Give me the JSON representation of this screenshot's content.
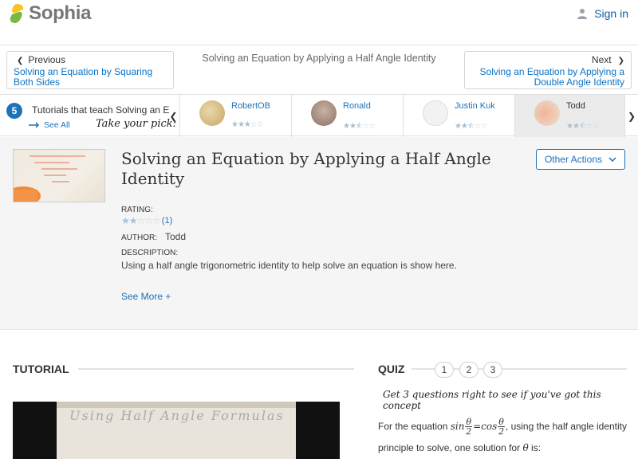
{
  "brand": {
    "name": "Sophia"
  },
  "header": {
    "signin_label": "Sign in"
  },
  "nav": {
    "previous_label": "Previous",
    "previous_link": "Solving an Equation by Squaring Both Sides",
    "current_title": "Solving an Equation by Applying a Half Angle Identity",
    "next_label": "Next",
    "next_link": "Solving an Equation by Applying a Double Angle Identity"
  },
  "tutorials_strip": {
    "count": "5",
    "text": "Tutorials that teach Solving an E",
    "see_all": "See All",
    "take_pick": "Take your pick:",
    "cards": [
      {
        "name": "RobertOB",
        "rating": 3,
        "selected": false
      },
      {
        "name": "Ronald",
        "rating": 2.5,
        "selected": false
      },
      {
        "name": "Justin Kuk",
        "rating": 2.5,
        "selected": false
      },
      {
        "name": "Todd",
        "rating": 2,
        "selected": true
      }
    ]
  },
  "detail": {
    "title": "Solving an Equation by Applying a Half Angle Identity",
    "other_actions": "Other Actions",
    "rating_label": "RATING:",
    "rating_value": 2,
    "rating_count": "(1)",
    "author_label": "AUTHOR:",
    "author": "Todd",
    "description_label": "DESCRIPTION:",
    "description": "Using a half angle trigonometric identity to help solve an equation is show here.",
    "see_more": "See More +",
    "thumb_text": "Using Half Angle Formulas"
  },
  "tutorial": {
    "heading": "TUTORIAL",
    "video_text": "Using Half Angle Formulas"
  },
  "quiz": {
    "heading": "QUIZ",
    "numbers": [
      "1",
      "2",
      "3"
    ],
    "tagline": "Get 3 questions right to see if you've got this concept",
    "question_prefix": "For the equation",
    "question_suffix": ", using the half angle identity principle to solve, one solution for",
    "question_end": "is:",
    "theta": "θ",
    "sin": "sin",
    "cos": "cos",
    "two": "2"
  },
  "colors": {
    "accent": "#1d72b8",
    "logo_yellow": "#f7c325",
    "logo_green": "#79b943"
  }
}
